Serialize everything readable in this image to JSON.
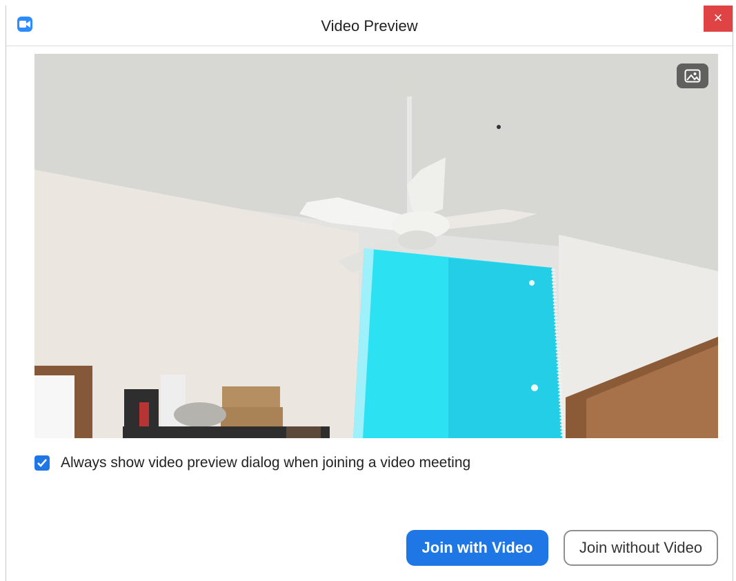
{
  "window": {
    "title": "Video Preview",
    "close_label": "×"
  },
  "preview": {
    "background_toggle_icon": "picture-icon"
  },
  "options": {
    "always_show_label": "Always show video preview dialog when joining a video meeting",
    "always_show_checked": true
  },
  "actions": {
    "join_with_video": "Join with Video",
    "join_without_video": "Join without Video"
  },
  "colors": {
    "primary": "#1f77e5",
    "close": "#e04343",
    "app_icon": "#2d8cff"
  }
}
